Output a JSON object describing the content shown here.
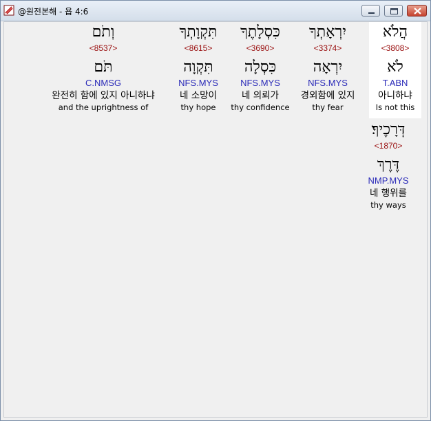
{
  "window": {
    "title": "@원전본해 - 욥 4:6"
  },
  "colors": {
    "strongs": "#9a1010",
    "morph": "#2a2ab8",
    "highlight_bg": "#ffffff"
  },
  "words": [
    {
      "hebrew": "הֲלֹא",
      "strongs": "<3808>",
      "root": "לֹא",
      "morph": "T.ABN",
      "korean": "아니하냐",
      "english": "Is not this",
      "highlighted": true
    },
    {
      "hebrew": "יִרְאָתְךָ",
      "strongs": "<3374>",
      "root": "יִרְאָה",
      "morph": "NFS.MYS",
      "korean": "경외함에 있지",
      "english": "thy fear",
      "highlighted": false
    },
    {
      "hebrew": "כִּסְלָתֶךָ",
      "strongs": "<3690>",
      "root": "כִּסְלָה",
      "morph": "NFS.MYS",
      "korean": "네 의뢰가",
      "english": "thy confidence",
      "highlighted": false
    },
    {
      "hebrew": "תִּקְוָתְךָ",
      "strongs": "<8615>",
      "root": "תִּקְוָה",
      "morph": "NFS.MYS",
      "korean": "네 소망이",
      "english": "thy hope",
      "highlighted": false
    },
    {
      "hebrew": "וְתֹם",
      "strongs": "<8537>",
      "root": "תֹּם",
      "morph": "C.NMSG",
      "korean": "완전히 함에 있지 아니하냐",
      "english": "and the uprightness of",
      "highlighted": false
    },
    {
      "hebrew": "דְּרָכֶיךָ׃",
      "strongs": "<1870>",
      "root": "דֶּרֶךְ",
      "morph": "NMP.MYS",
      "korean": "네 행위를",
      "english": "thy ways",
      "highlighted": false
    }
  ]
}
